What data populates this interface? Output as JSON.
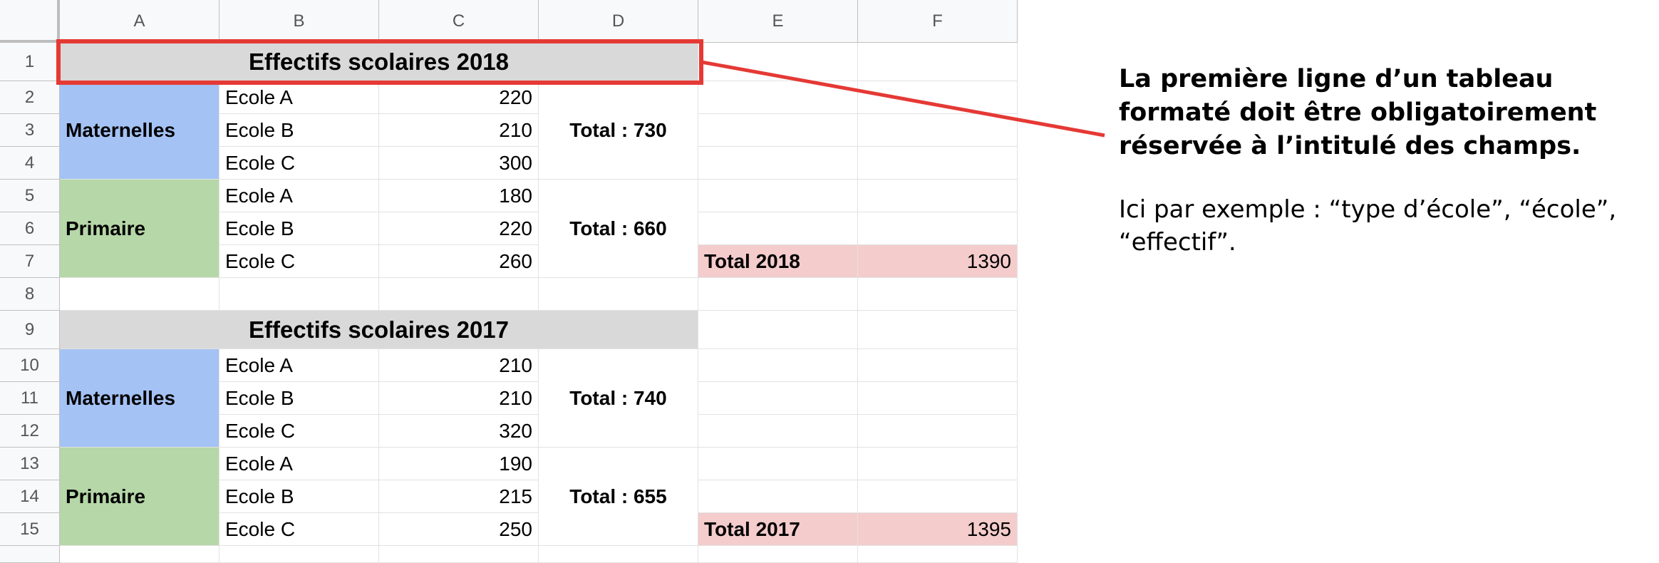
{
  "columns": [
    "A",
    "B",
    "C",
    "D",
    "E",
    "F"
  ],
  "rows": [
    "1",
    "2",
    "3",
    "4",
    "5",
    "6",
    "7",
    "8",
    "9",
    "10",
    "11",
    "12",
    "13",
    "14",
    "15"
  ],
  "table_2018": {
    "title": "Effectifs scolaires 2018",
    "maternelles": {
      "label": "Maternelles",
      "schools": [
        {
          "name": "Ecole A",
          "value": "220"
        },
        {
          "name": "Ecole B",
          "value": "210"
        },
        {
          "name": "Ecole C",
          "value": "300"
        }
      ],
      "total": "Total : 730"
    },
    "primaire": {
      "label": "Primaire",
      "schools": [
        {
          "name": "Ecole A",
          "value": "180"
        },
        {
          "name": "Ecole B",
          "value": "220"
        },
        {
          "name": "Ecole C",
          "value": "260"
        }
      ],
      "total": "Total : 660"
    },
    "grand_total_label": "Total 2018",
    "grand_total_value": "1390"
  },
  "table_2017": {
    "title": "Effectifs scolaires 2017",
    "maternelles": {
      "label": "Maternelles",
      "schools": [
        {
          "name": "Ecole A",
          "value": "210"
        },
        {
          "name": "Ecole B",
          "value": "210"
        },
        {
          "name": "Ecole C",
          "value": "320"
        }
      ],
      "total": "Total : 740"
    },
    "primaire": {
      "label": "Primaire",
      "schools": [
        {
          "name": "Ecole A",
          "value": "190"
        },
        {
          "name": "Ecole B",
          "value": "215"
        },
        {
          "name": "Ecole C",
          "value": "250"
        }
      ],
      "total": "Total : 655"
    },
    "grand_total_label": "Total 2017",
    "grand_total_value": "1395"
  },
  "annotation": {
    "bold_text": "La première ligne d’un tableau formaté doit être obligatoirement réservée à l’intitulé des champs.",
    "normal_text": "Ici par exemple : “type d’école”, “école”, “effectif”."
  },
  "colors": {
    "title_fill": "#d9d9d9",
    "maternelles_fill": "#a4c2f4",
    "primaire_fill": "#b6d7a8",
    "total_fill": "#f4cccc",
    "highlight": "#e53935"
  }
}
